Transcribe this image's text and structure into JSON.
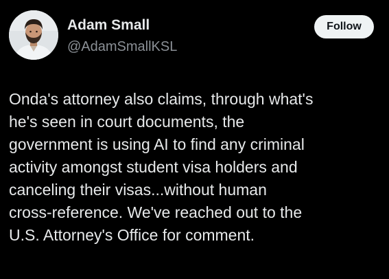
{
  "author": {
    "name": "Adam Small",
    "handle": "@AdamSmallKSL"
  },
  "follow_button": {
    "label": "Follow"
  },
  "post": {
    "lines": [
      "Onda's attorney also claims, through what's",
      "he's seen in court documents, the",
      "government is using AI to find any criminal",
      "activity amongst student visa holders and",
      "canceling their visas...without human",
      "cross-reference. We've reached out to the",
      "U.S. Attorney's Office for comment."
    ]
  },
  "colors": {
    "background": "#000000",
    "primary_text": "#e7e9ea",
    "secondary_text": "#8b9096",
    "button_bg": "#eff3f4",
    "button_text": "#0f1419"
  }
}
